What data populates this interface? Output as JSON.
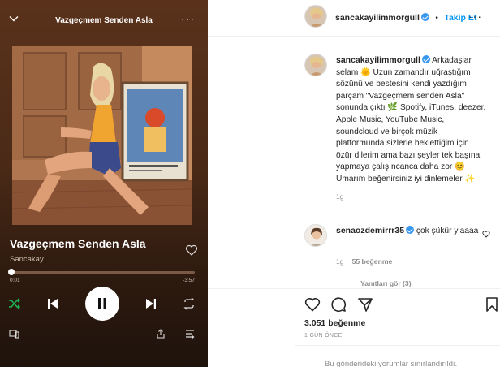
{
  "player": {
    "header_title": "Vazgeçmem Senden Asla",
    "song_title": "Vazgeçmem Senden Asla",
    "artist": "Sancakay",
    "time_elapsed": "0:01",
    "time_remaining": "-3:57",
    "progress": 0.004,
    "icons": [
      "chevron-down-icon",
      "more-icon",
      "heart-icon",
      "shuffle-icon",
      "previous-icon",
      "pause-icon",
      "next-icon",
      "repeat-icon",
      "devices-icon",
      "share-icon",
      "queue-icon"
    ],
    "colors": {
      "background": "#4a2a17",
      "accent": "#1db954"
    }
  },
  "post": {
    "username": "sancakayilimmorgull",
    "separator": "•",
    "follow_label": "Takip Et",
    "caption_text": "Arkadaşlar selam 🌞 Uzun zamandır uğraştığım sözünü ve bestesini kendi yazdığım parçam \"Vazgeçmem senden Asla\" sonunda çıktı 🌿 Spotify, iTunes, deezer, Apple Music, YouTube Music, soundcloud ve birçok müzik platformunda sizlerle beklettiğim için özür dilerim ama bazı şeyler tek başına yapmaya çalışıncanca daha zor 😊 Umarım beğenirsiniz iyi dinlemeler ✨",
    "caption_time": "1g",
    "comment": {
      "username": "senaozdemirrr35",
      "text": "çok şükür yiaaaa",
      "time": "1g",
      "likes": "55 beğenme",
      "replies_label": "Yanıtları gör (3)"
    },
    "likes": "3.051 beğenme",
    "date": "1 GÜN ÖNCE",
    "comments_closed": "Bu gönderideki yorumlar sınırlandırıldı.",
    "colors": {
      "link": "#0095f6",
      "verified": "#3897f0"
    }
  }
}
